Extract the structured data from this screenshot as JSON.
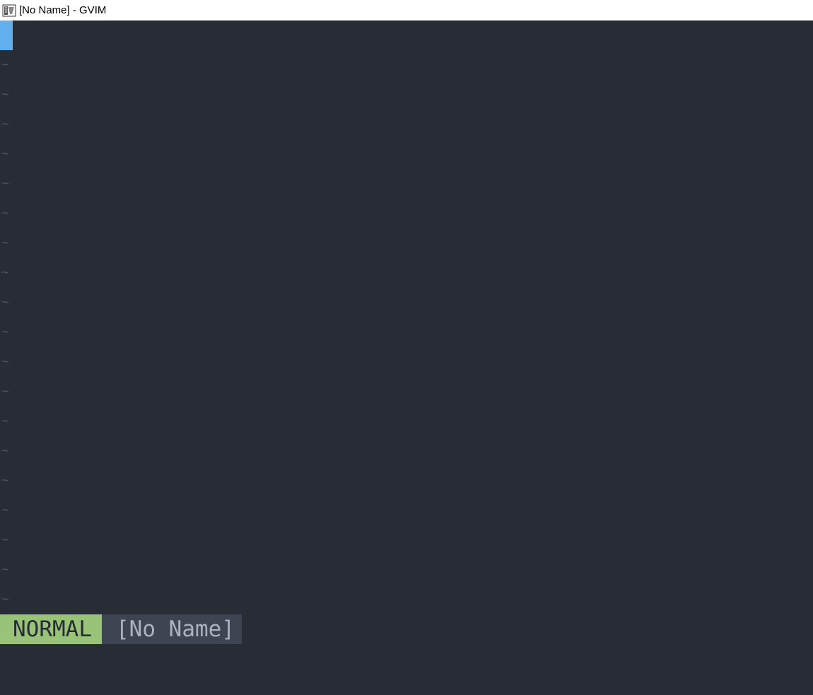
{
  "window": {
    "title": "[No Name] - GVIM",
    "icon": "gvim-icon"
  },
  "editor": {
    "tilde": "~",
    "empty_line_count": 19
  },
  "statusline": {
    "mode": "NORMAL",
    "filename": "[No Name]"
  },
  "colors": {
    "background": "#282c34",
    "cursor": "#61afef",
    "mode_bg": "#98c379",
    "filename_bg": "#3e4452",
    "tilde": "#4b5263"
  }
}
